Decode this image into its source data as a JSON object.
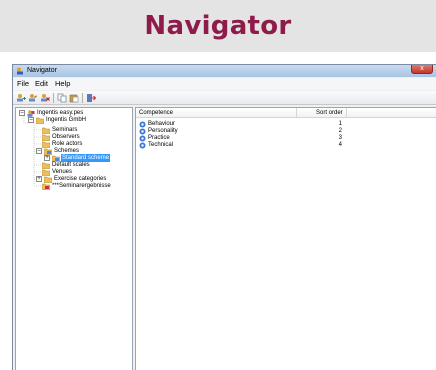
{
  "banner": {
    "title": "Navigator"
  },
  "window": {
    "title": "Navigator",
    "close_label": "x",
    "menu": [
      "File",
      "Edit",
      "Help"
    ],
    "toolbar_icons": [
      "add-icon",
      "edit-icon",
      "delete-icon",
      "copy-icon",
      "paste-icon",
      "exit-icon"
    ]
  },
  "tree": {
    "root": "Ingentis easy.pes",
    "company": "Ingentis GmbH",
    "seminars": "Seminars",
    "observers": "Observers",
    "role_actors": "Role actors",
    "schemes": "Schemes",
    "standard_scheme": "Standard scheme",
    "default_scales": "Default scales",
    "venues": "Venues",
    "exercise_categories": "Exercise categories",
    "seminar_results": "***Seminarergebnisse"
  },
  "list": {
    "columns": [
      "Competence",
      "Sort order"
    ],
    "rows": [
      {
        "name": "Behaviour",
        "order": "1"
      },
      {
        "name": "Personality",
        "order": "2"
      },
      {
        "name": "Practice",
        "order": "3"
      },
      {
        "name": "Technical",
        "order": "4"
      }
    ]
  }
}
